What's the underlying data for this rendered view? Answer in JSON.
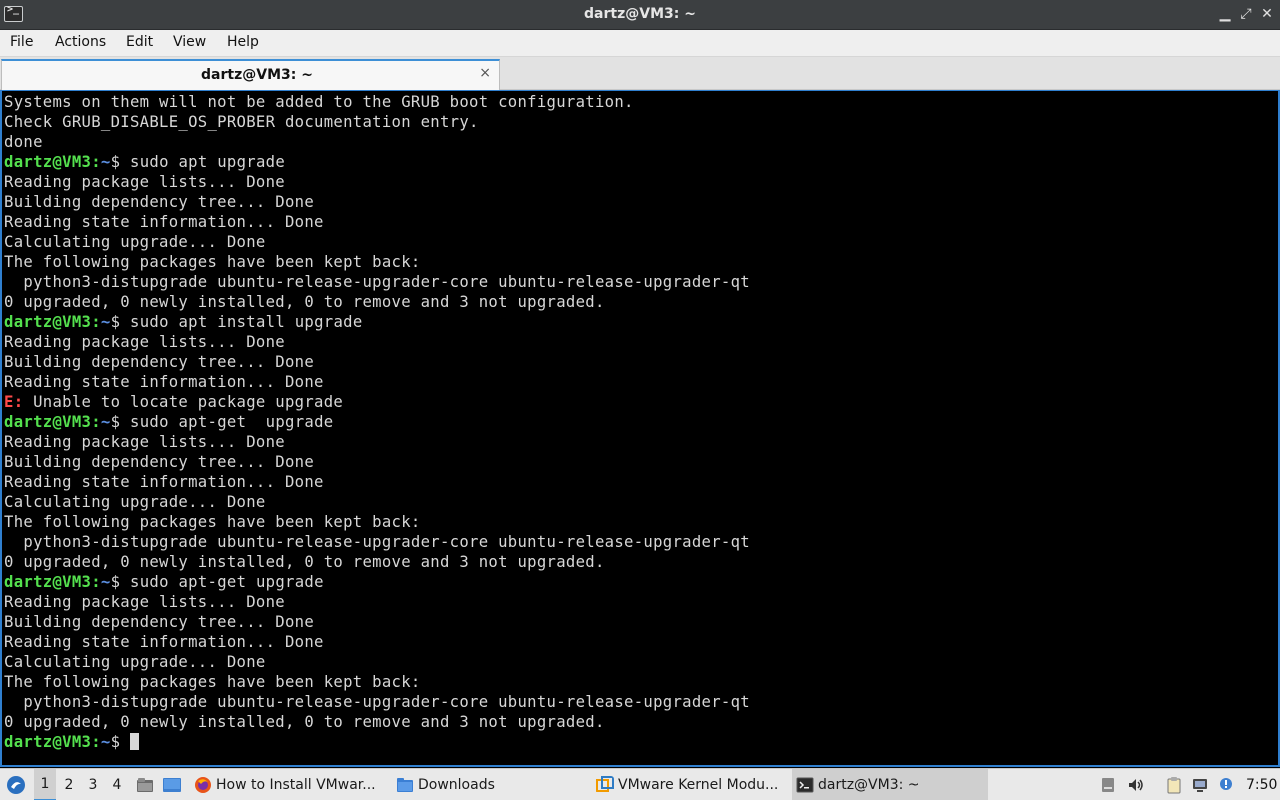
{
  "window": {
    "title": "dartz@VM3: ~",
    "icon": "terminal-icon",
    "controls": [
      "minimize-icon",
      "restore-icon",
      "close-icon"
    ]
  },
  "menu": [
    "File",
    "Actions",
    "Edit",
    "View",
    "Help"
  ],
  "tab": {
    "label": "dartz@VM3: ~",
    "close": "×"
  },
  "prompt": {
    "user": "dartz@VM3",
    "sep": ":",
    "path": "~",
    "sym": "$ "
  },
  "terminal": {
    "colors": {
      "user": "#54e04e",
      "path": "#5b8ee0",
      "error": "#ff4a4a",
      "text": "#d7d7d7",
      "background": "#000000"
    },
    "lines": [
      {
        "type": "out",
        "text": "Systems on them will not be added to the GRUB boot configuration."
      },
      {
        "type": "out",
        "text": "Check GRUB_DISABLE_OS_PROBER documentation entry."
      },
      {
        "type": "out",
        "text": "done"
      },
      {
        "type": "cmd",
        "text": "sudo apt upgrade"
      },
      {
        "type": "out",
        "text": "Reading package lists... Done"
      },
      {
        "type": "out",
        "text": "Building dependency tree... Done"
      },
      {
        "type": "out",
        "text": "Reading state information... Done"
      },
      {
        "type": "out",
        "text": "Calculating upgrade... Done"
      },
      {
        "type": "out",
        "text": "The following packages have been kept back:"
      },
      {
        "type": "out",
        "text": "  python3-distupgrade ubuntu-release-upgrader-core ubuntu-release-upgrader-qt"
      },
      {
        "type": "out",
        "text": "0 upgraded, 0 newly installed, 0 to remove and 3 not upgraded."
      },
      {
        "type": "cmd",
        "text": "sudo apt install upgrade"
      },
      {
        "type": "out",
        "text": "Reading package lists... Done"
      },
      {
        "type": "out",
        "text": "Building dependency tree... Done"
      },
      {
        "type": "out",
        "text": "Reading state information... Done"
      },
      {
        "type": "err",
        "label": "E:",
        "text": " Unable to locate package upgrade"
      },
      {
        "type": "cmd",
        "text": "sudo apt-get  upgrade"
      },
      {
        "type": "out",
        "text": "Reading package lists... Done"
      },
      {
        "type": "out",
        "text": "Building dependency tree... Done"
      },
      {
        "type": "out",
        "text": "Reading state information... Done"
      },
      {
        "type": "out",
        "text": "Calculating upgrade... Done"
      },
      {
        "type": "out",
        "text": "The following packages have been kept back:"
      },
      {
        "type": "out",
        "text": "  python3-distupgrade ubuntu-release-upgrader-core ubuntu-release-upgrader-qt"
      },
      {
        "type": "out",
        "text": "0 upgraded, 0 newly installed, 0 to remove and 3 not upgraded."
      },
      {
        "type": "cmd",
        "text": "sudo apt-get upgrade"
      },
      {
        "type": "out",
        "text": "Reading package lists... Done"
      },
      {
        "type": "out",
        "text": "Building dependency tree... Done"
      },
      {
        "type": "out",
        "text": "Reading state information... Done"
      },
      {
        "type": "out",
        "text": "Calculating upgrade... Done"
      },
      {
        "type": "out",
        "text": "The following packages have been kept back:"
      },
      {
        "type": "out",
        "text": "  python3-distupgrade ubuntu-release-upgrader-core ubuntu-release-upgrader-qt"
      },
      {
        "type": "out",
        "text": "0 upgraded, 0 newly installed, 0 to remove and 3 not upgraded."
      },
      {
        "type": "cmd",
        "text": "",
        "cursor": true
      }
    ]
  },
  "taskbar": {
    "start_icon": "lubuntu-start-icon",
    "workspaces": [
      "1",
      "2",
      "3",
      "4"
    ],
    "active_workspace": "1",
    "quicklaunch": [
      "file-manager-icon",
      "show-desktop-icon"
    ],
    "tasks": [
      {
        "label": "How to Install VMwar...",
        "icon": "firefox-icon"
      },
      {
        "label": "Downloads",
        "icon": "folder-icon"
      },
      {
        "label": "VMware Kernel Modu...",
        "icon": "vmware-icon"
      },
      {
        "label": "dartz@VM3: ~",
        "icon": "terminal-icon",
        "active": true
      }
    ],
    "tray": [
      "removable-drive-icon",
      "volume-icon",
      "clipboard-icon",
      "network-icon",
      "notification-icon"
    ],
    "clock": "7:50"
  }
}
